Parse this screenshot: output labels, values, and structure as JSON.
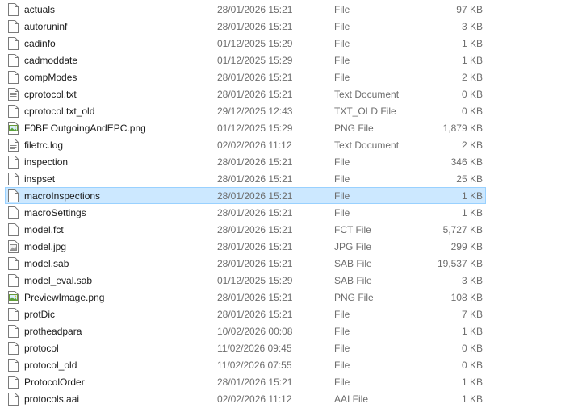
{
  "files": [
    {
      "name": "actuals",
      "date": "28/01/2026 15:21",
      "type": "File",
      "size": "97 KB",
      "icon": "blank-file-icon"
    },
    {
      "name": "autoruninf",
      "date": "28/01/2026 15:21",
      "type": "File",
      "size": "3 KB",
      "icon": "blank-file-icon"
    },
    {
      "name": "cadinfo",
      "date": "01/12/2025 15:29",
      "type": "File",
      "size": "1 KB",
      "icon": "blank-file-icon"
    },
    {
      "name": "cadmoddate",
      "date": "01/12/2025 15:29",
      "type": "File",
      "size": "1 KB",
      "icon": "blank-file-icon"
    },
    {
      "name": "compModes",
      "date": "28/01/2026 15:21",
      "type": "File",
      "size": "2 KB",
      "icon": "blank-file-icon"
    },
    {
      "name": "cprotocol.txt",
      "date": "28/01/2026 15:21",
      "type": "Text Document",
      "size": "0 KB",
      "icon": "text-document-icon"
    },
    {
      "name": "cprotocol.txt_old",
      "date": "29/12/2025 12:43",
      "type": "TXT_OLD File",
      "size": "0 KB",
      "icon": "blank-file-icon"
    },
    {
      "name": "F0BF OutgoingAndEPC.png",
      "date": "01/12/2025 15:29",
      "type": "PNG File",
      "size": "1,879 KB",
      "icon": "image-file-icon"
    },
    {
      "name": "filetrc.log",
      "date": "02/02/2026 11:12",
      "type": "Text Document",
      "size": "2 KB",
      "icon": "text-document-icon"
    },
    {
      "name": "inspection",
      "date": "28/01/2026 15:21",
      "type": "File",
      "size": "346 KB",
      "icon": "blank-file-icon"
    },
    {
      "name": "inspset",
      "date": "28/01/2026 15:21",
      "type": "File",
      "size": "25 KB",
      "icon": "blank-file-icon"
    },
    {
      "name": "macroInspections",
      "date": "28/01/2026 15:21",
      "type": "File",
      "size": "1 KB",
      "icon": "blank-file-icon",
      "selected": true
    },
    {
      "name": "macroSettings",
      "date": "28/01/2026 15:21",
      "type": "File",
      "size": "1 KB",
      "icon": "blank-file-icon"
    },
    {
      "name": "model.fct",
      "date": "28/01/2026 15:21",
      "type": "FCT File",
      "size": "5,727 KB",
      "icon": "blank-file-icon"
    },
    {
      "name": "model.jpg",
      "date": "28/01/2026 15:21",
      "type": "JPG File",
      "size": "299 KB",
      "icon": "jpg-file-icon"
    },
    {
      "name": "model.sab",
      "date": "28/01/2026 15:21",
      "type": "SAB File",
      "size": "19,537 KB",
      "icon": "blank-file-icon"
    },
    {
      "name": "model_eval.sab",
      "date": "01/12/2025 15:29",
      "type": "SAB File",
      "size": "3 KB",
      "icon": "blank-file-icon"
    },
    {
      "name": "PreviewImage.png",
      "date": "28/01/2026 15:21",
      "type": "PNG File",
      "size": "108 KB",
      "icon": "image-file-icon"
    },
    {
      "name": "protDic",
      "date": "28/01/2026 15:21",
      "type": "File",
      "size": "7 KB",
      "icon": "blank-file-icon"
    },
    {
      "name": "protheadpara",
      "date": "10/02/2026 00:08",
      "type": "File",
      "size": "1 KB",
      "icon": "blank-file-icon"
    },
    {
      "name": "protocol",
      "date": "11/02/2026 09:45",
      "type": "File",
      "size": "0 KB",
      "icon": "blank-file-icon"
    },
    {
      "name": "protocol_old",
      "date": "11/02/2026 07:55",
      "type": "File",
      "size": "0 KB",
      "icon": "blank-file-icon"
    },
    {
      "name": "ProtocolOrder",
      "date": "28/01/2026 15:21",
      "type": "File",
      "size": "1 KB",
      "icon": "blank-file-icon"
    },
    {
      "name": "protocols.aai",
      "date": "02/02/2026 11:12",
      "type": "AAI File",
      "size": "1 KB",
      "icon": "blank-file-icon"
    }
  ],
  "colors": {
    "selection_bg": "#cce8ff",
    "selection_border": "#99d1ff",
    "name_text": "#1a1a1a",
    "detail_text": "#6d6d6d"
  }
}
